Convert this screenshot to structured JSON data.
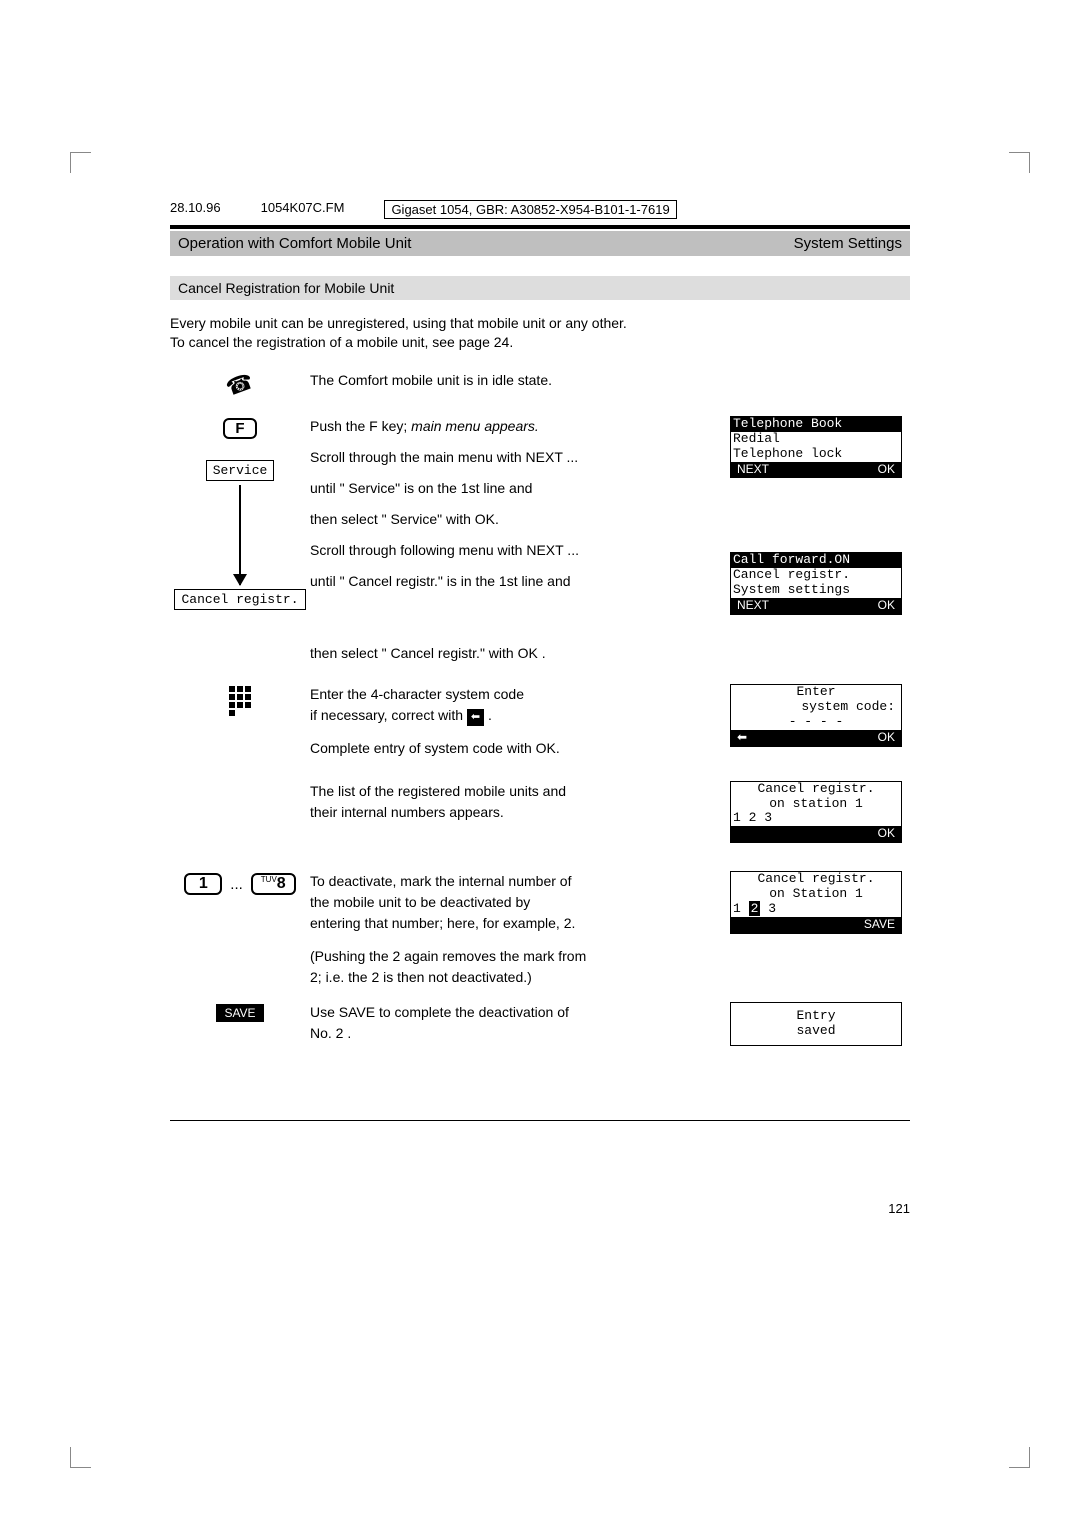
{
  "header": {
    "date": "28.10.96",
    "file": "1054K07C.FM",
    "doc_id": "Gigaset 1054, GBR: A30852-X954-B101-1-7619"
  },
  "title": "Operation with Comfort Mobile Unit",
  "subtitle_right": "System Settings",
  "section": "Cancel Registration for Mobile Unit",
  "intro_l1": "Every mobile unit can be unregistered, using that mobile unit or any other.",
  "intro_l2": "To cancel the registration of a mobile unit, see page 24.",
  "steps": {
    "idle": "The Comfort mobile unit is in idle state.",
    "push_f_pre": "Push the F key; ",
    "push_f_em": "main menu appears.",
    "scroll_next": "Scroll through the main menu with NEXT ...",
    "until_service": "until \" Service\" is on the 1st line and",
    "select_service": "then select \" Service\" with OK.",
    "scroll_follow": "Scroll through following menu with NEXT ...",
    "until_cancel": "until \" Cancel registr.\" is in the 1st line and",
    "select_cancel": "then select \" Cancel registr.\" with OK .",
    "enter_code_l1": "Enter the 4-character system code",
    "enter_code_l2_pre": "if necessary, correct with ",
    "enter_code_l2_post": " .",
    "complete_code": "Complete entry of system code with OK.",
    "list_l1": "The list of the registered mobile units and",
    "list_l2": "their internal numbers appears.",
    "deact_l1": "To deactivate, mark the internal number of",
    "deact_l2": "the mobile unit to be deactivated by",
    "deact_l3": "entering that number; here, for example, 2.",
    "push2_l1": "(Pushing the 2 again removes the mark from",
    "push2_l2": "2; i.e. the 2 is then not deactivated.)",
    "save_l1": "Use SAVE to complete the deactivation of",
    "save_l2": "No. 2 ."
  },
  "boxes": {
    "service": "Service",
    "cancel": "Cancel registr."
  },
  "keys": {
    "f": "F",
    "one": "1",
    "eight": "8",
    "eight_sup": "TUV",
    "ellipsis": "...",
    "save": "SAVE",
    "back": "⬅"
  },
  "lcd1": {
    "l1": "Telephone Book",
    "l2": "Redial",
    "l3": "Telephone lock",
    "left": "NEXT",
    "right": "OK"
  },
  "lcd2": {
    "l1": "Call forward.ON",
    "l2": "Cancel registr.",
    "l3": "System settings",
    "left": "NEXT",
    "right": "OK"
  },
  "lcd3": {
    "l1": "Enter",
    "l2": "system code:",
    "l3": "- - - -",
    "left": "⬅",
    "right": "OK"
  },
  "lcd4": {
    "l1": "Cancel registr.",
    "l2": "on station 1",
    "l3": "1 2 3",
    "right": "OK"
  },
  "lcd5": {
    "l1": "Cancel registr.",
    "l2": "on Station 1",
    "l3_pre": "1 ",
    "l3_mark": "2",
    "l3_post": " 3",
    "right": "SAVE"
  },
  "lcd6": {
    "l1": "Entry",
    "l2": "saved"
  },
  "page_number": "121"
}
